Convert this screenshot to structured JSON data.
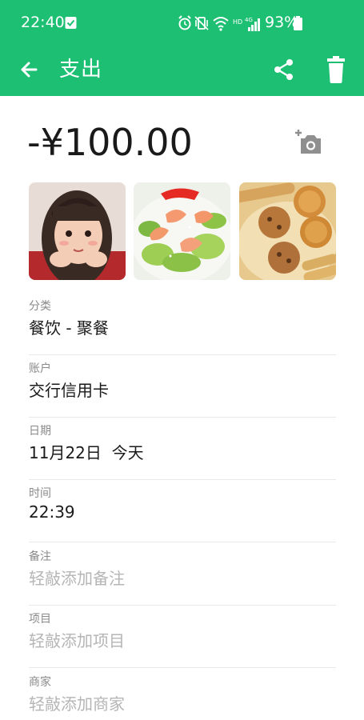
{
  "status_bar": {
    "time": "22:40",
    "battery_percent": "93%",
    "network_label": "4G",
    "hd_label": "HD",
    "icons": [
      "check-square-icon",
      "alarm-icon",
      "vibrate-off-icon",
      "wifi-icon",
      "signal-icon",
      "battery-icon"
    ]
  },
  "app_bar": {
    "title": "支出",
    "back_icon": "arrow-left-icon",
    "share_icon": "share-icon",
    "delete_icon": "trash-icon",
    "color": "#1dbf73"
  },
  "transaction": {
    "amount": "-¥100.00",
    "add_photo_icon": "add-photo-icon",
    "photos": [
      {
        "subject": "child-portrait"
      },
      {
        "subject": "shrimp-dish"
      },
      {
        "subject": "cookies"
      }
    ]
  },
  "fields": [
    {
      "label": "分类",
      "value": "餐饮 - 聚餐",
      "placeholder": false
    },
    {
      "label": "账户",
      "value": "交行信用卡",
      "placeholder": false
    },
    {
      "label": "日期",
      "value": "11月22日  今天",
      "placeholder": false
    },
    {
      "label": "时间",
      "value": "22:39",
      "placeholder": false
    },
    {
      "label": "备注",
      "value": "轻敲添加备注",
      "placeholder": true
    },
    {
      "label": "项目",
      "value": "轻敲添加项目",
      "placeholder": true
    },
    {
      "label": "商家",
      "value": "轻敲添加商家",
      "placeholder": true
    }
  ]
}
